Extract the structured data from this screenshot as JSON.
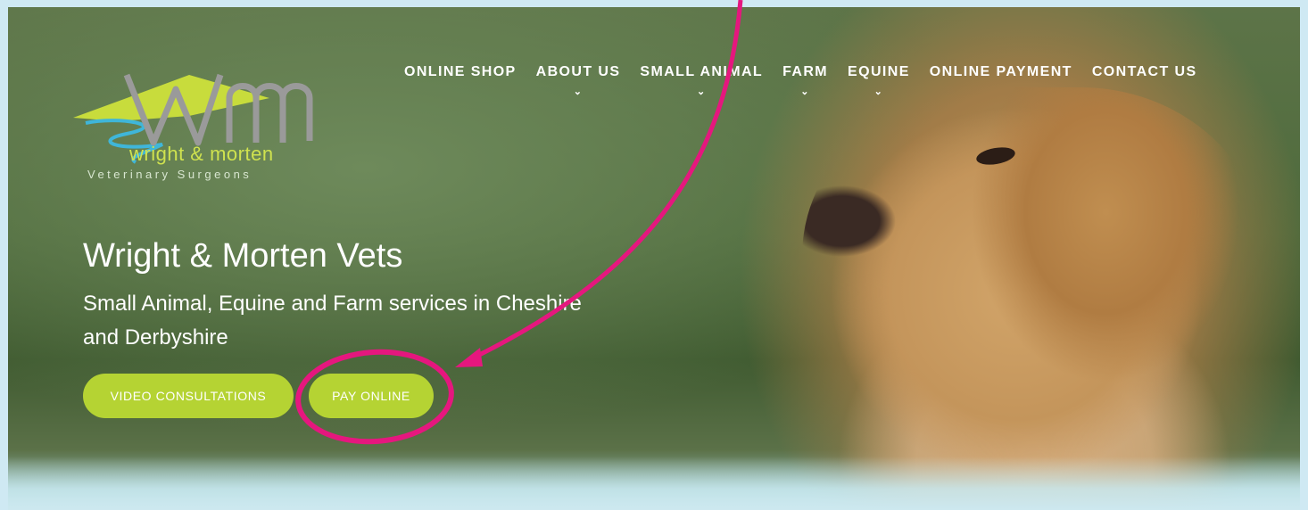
{
  "logo": {
    "mark": "wm",
    "name": "wright & morten",
    "tagline": "Veterinary Surgeons"
  },
  "nav": {
    "items": [
      {
        "label": "ONLINE SHOP",
        "dropdown": false
      },
      {
        "label": "ABOUT US",
        "dropdown": true
      },
      {
        "label": "SMALL ANIMAL",
        "dropdown": true
      },
      {
        "label": "FARM",
        "dropdown": true
      },
      {
        "label": "EQUINE",
        "dropdown": true
      },
      {
        "label": "ONLINE PAYMENT",
        "dropdown": false
      },
      {
        "label": "CONTACT US",
        "dropdown": false
      }
    ]
  },
  "hero": {
    "title": "Wright & Morten Vets",
    "subtitle": "Small Animal, Equine and Farm services in Cheshire and Derbyshire",
    "buttons": {
      "video": "VIDEO CONSULTATIONS",
      "pay": "PAY ONLINE"
    }
  },
  "colors": {
    "accent": "#b5d333",
    "annotation": "#e5177e",
    "frame": "#cfe9f3"
  }
}
